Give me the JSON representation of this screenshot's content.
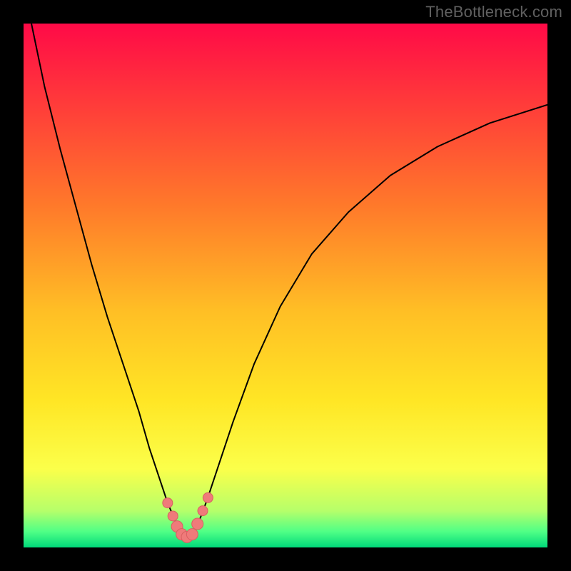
{
  "watermark": "TheBottleneck.com",
  "chart_data": {
    "type": "line",
    "title": "",
    "xlabel": "",
    "ylabel": "",
    "xlim": [
      0,
      100
    ],
    "ylim": [
      0,
      100
    ],
    "grid": false,
    "legend": false,
    "background_gradient": {
      "stops": [
        {
          "pos": 0.0,
          "color": "#ff0a47"
        },
        {
          "pos": 0.15,
          "color": "#ff3a3a"
        },
        {
          "pos": 0.35,
          "color": "#ff7a2a"
        },
        {
          "pos": 0.55,
          "color": "#ffbf25"
        },
        {
          "pos": 0.72,
          "color": "#ffe625"
        },
        {
          "pos": 0.85,
          "color": "#fbff4a"
        },
        {
          "pos": 0.93,
          "color": "#b6ff6a"
        },
        {
          "pos": 0.97,
          "color": "#4fff86"
        },
        {
          "pos": 1.0,
          "color": "#00d97a"
        }
      ]
    },
    "series": [
      {
        "name": "curve-main",
        "stroke": "#000000",
        "stroke_width": 2,
        "x": [
          1.5,
          4.0,
          7.0,
          10.0,
          13.0,
          16.0,
          19.0,
          22.0,
          24.0,
          26.0,
          27.5,
          29.0,
          30.0,
          31.0,
          32.0,
          33.5,
          35.0,
          37.0,
          40.0,
          44.0,
          49.0,
          55.0,
          62.0,
          70.0,
          79.0,
          89.0,
          100.0
        ],
        "y": [
          100.0,
          88.0,
          76.0,
          65.0,
          54.0,
          44.0,
          35.0,
          26.0,
          19.0,
          13.0,
          8.5,
          5.0,
          2.5,
          2.0,
          2.5,
          5.0,
          9.0,
          15.0,
          24.0,
          35.0,
          46.0,
          56.0,
          64.0,
          71.0,
          76.5,
          81.0,
          84.5
        ]
      }
    ],
    "markers": {
      "name": "bottom-dots",
      "fill": "#ef7a7a",
      "stroke": "#d86060",
      "radius_small": 7,
      "radius_large": 8,
      "points": [
        {
          "x": 27.5,
          "y": 8.5,
          "r": 7
        },
        {
          "x": 28.5,
          "y": 6.0,
          "r": 7
        },
        {
          "x": 29.3,
          "y": 4.0,
          "r": 8
        },
        {
          "x": 30.2,
          "y": 2.5,
          "r": 8
        },
        {
          "x": 31.2,
          "y": 2.0,
          "r": 8
        },
        {
          "x": 32.2,
          "y": 2.5,
          "r": 8
        },
        {
          "x": 33.2,
          "y": 4.5,
          "r": 8
        },
        {
          "x": 34.2,
          "y": 7.0,
          "r": 7
        },
        {
          "x": 35.2,
          "y": 9.5,
          "r": 7
        }
      ]
    }
  }
}
